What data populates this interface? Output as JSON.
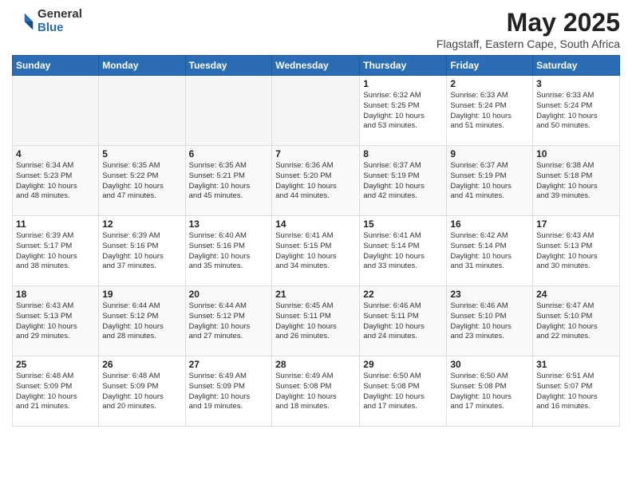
{
  "logo": {
    "general": "General",
    "blue": "Blue"
  },
  "title": "May 2025",
  "subtitle": "Flagstaff, Eastern Cape, South Africa",
  "weekdays": [
    "Sunday",
    "Monday",
    "Tuesday",
    "Wednesday",
    "Thursday",
    "Friday",
    "Saturday"
  ],
  "weeks": [
    [
      {
        "day": "",
        "info": ""
      },
      {
        "day": "",
        "info": ""
      },
      {
        "day": "",
        "info": ""
      },
      {
        "day": "",
        "info": ""
      },
      {
        "day": "1",
        "info": "Sunrise: 6:32 AM\nSunset: 5:25 PM\nDaylight: 10 hours\nand 53 minutes."
      },
      {
        "day": "2",
        "info": "Sunrise: 6:33 AM\nSunset: 5:24 PM\nDaylight: 10 hours\nand 51 minutes."
      },
      {
        "day": "3",
        "info": "Sunrise: 6:33 AM\nSunset: 5:24 PM\nDaylight: 10 hours\nand 50 minutes."
      }
    ],
    [
      {
        "day": "4",
        "info": "Sunrise: 6:34 AM\nSunset: 5:23 PM\nDaylight: 10 hours\nand 48 minutes."
      },
      {
        "day": "5",
        "info": "Sunrise: 6:35 AM\nSunset: 5:22 PM\nDaylight: 10 hours\nand 47 minutes."
      },
      {
        "day": "6",
        "info": "Sunrise: 6:35 AM\nSunset: 5:21 PM\nDaylight: 10 hours\nand 45 minutes."
      },
      {
        "day": "7",
        "info": "Sunrise: 6:36 AM\nSunset: 5:20 PM\nDaylight: 10 hours\nand 44 minutes."
      },
      {
        "day": "8",
        "info": "Sunrise: 6:37 AM\nSunset: 5:19 PM\nDaylight: 10 hours\nand 42 minutes."
      },
      {
        "day": "9",
        "info": "Sunrise: 6:37 AM\nSunset: 5:19 PM\nDaylight: 10 hours\nand 41 minutes."
      },
      {
        "day": "10",
        "info": "Sunrise: 6:38 AM\nSunset: 5:18 PM\nDaylight: 10 hours\nand 39 minutes."
      }
    ],
    [
      {
        "day": "11",
        "info": "Sunrise: 6:39 AM\nSunset: 5:17 PM\nDaylight: 10 hours\nand 38 minutes."
      },
      {
        "day": "12",
        "info": "Sunrise: 6:39 AM\nSunset: 5:16 PM\nDaylight: 10 hours\nand 37 minutes."
      },
      {
        "day": "13",
        "info": "Sunrise: 6:40 AM\nSunset: 5:16 PM\nDaylight: 10 hours\nand 35 minutes."
      },
      {
        "day": "14",
        "info": "Sunrise: 6:41 AM\nSunset: 5:15 PM\nDaylight: 10 hours\nand 34 minutes."
      },
      {
        "day": "15",
        "info": "Sunrise: 6:41 AM\nSunset: 5:14 PM\nDaylight: 10 hours\nand 33 minutes."
      },
      {
        "day": "16",
        "info": "Sunrise: 6:42 AM\nSunset: 5:14 PM\nDaylight: 10 hours\nand 31 minutes."
      },
      {
        "day": "17",
        "info": "Sunrise: 6:43 AM\nSunset: 5:13 PM\nDaylight: 10 hours\nand 30 minutes."
      }
    ],
    [
      {
        "day": "18",
        "info": "Sunrise: 6:43 AM\nSunset: 5:13 PM\nDaylight: 10 hours\nand 29 minutes."
      },
      {
        "day": "19",
        "info": "Sunrise: 6:44 AM\nSunset: 5:12 PM\nDaylight: 10 hours\nand 28 minutes."
      },
      {
        "day": "20",
        "info": "Sunrise: 6:44 AM\nSunset: 5:12 PM\nDaylight: 10 hours\nand 27 minutes."
      },
      {
        "day": "21",
        "info": "Sunrise: 6:45 AM\nSunset: 5:11 PM\nDaylight: 10 hours\nand 26 minutes."
      },
      {
        "day": "22",
        "info": "Sunrise: 6:46 AM\nSunset: 5:11 PM\nDaylight: 10 hours\nand 24 minutes."
      },
      {
        "day": "23",
        "info": "Sunrise: 6:46 AM\nSunset: 5:10 PM\nDaylight: 10 hours\nand 23 minutes."
      },
      {
        "day": "24",
        "info": "Sunrise: 6:47 AM\nSunset: 5:10 PM\nDaylight: 10 hours\nand 22 minutes."
      }
    ],
    [
      {
        "day": "25",
        "info": "Sunrise: 6:48 AM\nSunset: 5:09 PM\nDaylight: 10 hours\nand 21 minutes."
      },
      {
        "day": "26",
        "info": "Sunrise: 6:48 AM\nSunset: 5:09 PM\nDaylight: 10 hours\nand 20 minutes."
      },
      {
        "day": "27",
        "info": "Sunrise: 6:49 AM\nSunset: 5:09 PM\nDaylight: 10 hours\nand 19 minutes."
      },
      {
        "day": "28",
        "info": "Sunrise: 6:49 AM\nSunset: 5:08 PM\nDaylight: 10 hours\nand 18 minutes."
      },
      {
        "day": "29",
        "info": "Sunrise: 6:50 AM\nSunset: 5:08 PM\nDaylight: 10 hours\nand 17 minutes."
      },
      {
        "day": "30",
        "info": "Sunrise: 6:50 AM\nSunset: 5:08 PM\nDaylight: 10 hours\nand 17 minutes."
      },
      {
        "day": "31",
        "info": "Sunrise: 6:51 AM\nSunset: 5:07 PM\nDaylight: 10 hours\nand 16 minutes."
      }
    ]
  ]
}
